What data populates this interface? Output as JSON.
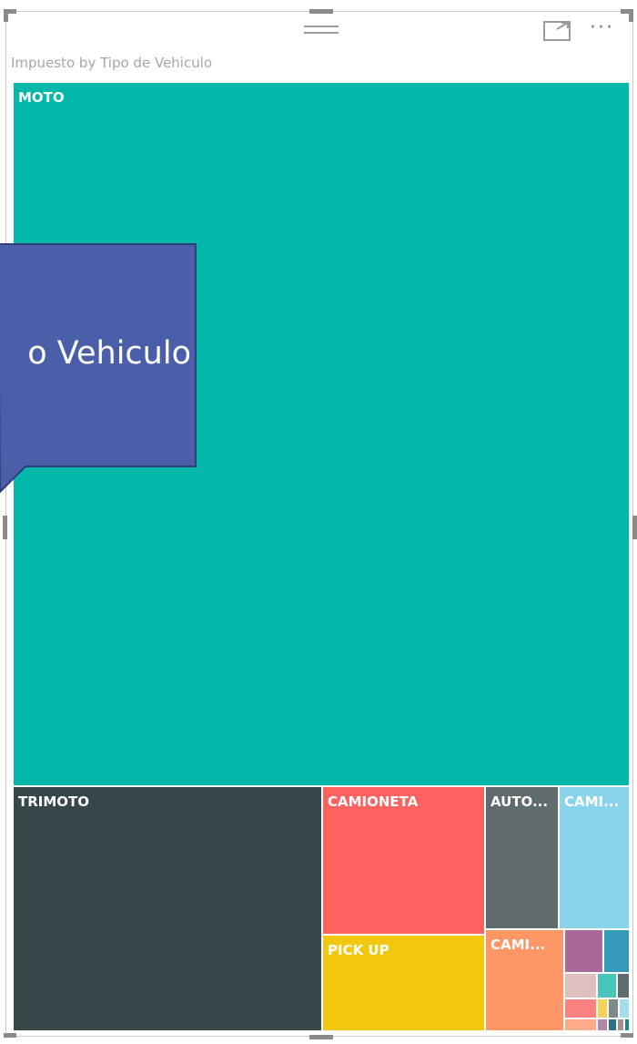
{
  "header": {
    "menu_icon": "hamburger-icon",
    "focus_icon": "focus-mode-icon",
    "more_icon": "more-options-icon",
    "more_glyph": "···"
  },
  "visual_title": "Impuesto by Tipo de Vehiculo",
  "callout": {
    "text": "o Vehiculo",
    "color": "#4b5ea9"
  },
  "chart_data": {
    "type": "treemap",
    "title": "Impuesto by Tipo de Vehiculo",
    "category_field": "Tipo de Vehiculo",
    "value_field": "Impuesto",
    "labeled_tiles": [
      {
        "label": "MOTO",
        "value": 13800,
        "color": "#01b8aa",
        "label_color": "#ffffff"
      },
      {
        "label": "TRIMOTO",
        "value": 2300,
        "color": "#374649",
        "label_color": "#ffffff"
      },
      {
        "label": "CAMIONETA",
        "value": 595,
        "color": "#fd625e",
        "label_color": "#ffffff"
      },
      {
        "label": "PICK UP",
        "value": 390,
        "color": "#f2c80f",
        "label_color": "#ffffff"
      },
      {
        "label": "AUTO...",
        "value": 270,
        "color": "#5f6b6d",
        "label_color": "#ffffff"
      },
      {
        "label": "CAMI...",
        "value": 230,
        "color": "#8ad4eb",
        "label_color": "#ffffff"
      },
      {
        "label": "CAMI...",
        "value": 125,
        "color": "#fe9666",
        "label_color": "#ffffff"
      }
    ],
    "small_tiles": [
      {
        "value": 30,
        "color": "#a66999"
      },
      {
        "value": 22,
        "color": "#3599b8"
      },
      {
        "value": 18,
        "color": "#dfbfbf"
      },
      {
        "value": 12,
        "color": "#4ac5bb"
      },
      {
        "value": 9,
        "color": "#5f6b6d"
      },
      {
        "value": 8,
        "color": "#fb8281"
      },
      {
        "value": 7,
        "color": "#f4d25a"
      },
      {
        "value": 6,
        "color": "#7f898a"
      },
      {
        "value": 5,
        "color": "#a4ddee"
      },
      {
        "value": 5,
        "color": "#fdab89"
      },
      {
        "value": 4,
        "color": "#b687ac"
      },
      {
        "value": 4,
        "color": "#28738a"
      },
      {
        "value": 3,
        "color": "#a78f8f"
      },
      {
        "value": 3,
        "color": "#168980"
      }
    ]
  }
}
